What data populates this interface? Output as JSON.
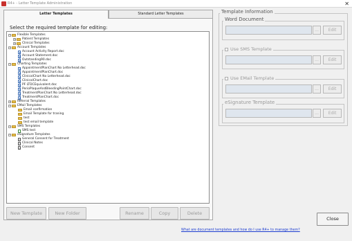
{
  "window": {
    "title": "R4+ - Letter Template Administration",
    "close_glyph": "✕"
  },
  "tabs": [
    {
      "label": "Letter Templates",
      "active": true
    },
    {
      "label": "Standard Letter Templates",
      "active": false
    }
  ],
  "tree_prompt": "Select the required template for editing:",
  "tree": {
    "flexible": {
      "label": "Flexible Templates",
      "children": [
        "Patient Templates",
        "Clinical Templates"
      ]
    },
    "account": {
      "label": "Account Templates",
      "children": [
        "Account Activity Report.doc",
        "Account Statement.doc",
        "Outstanding90.doc"
      ]
    },
    "charting": {
      "label": "Charting Templates",
      "children": [
        "AppointmentPlanChart No Letterhead.doc",
        "AppointmentPlanChart.doc",
        "ClinicalChart No Letterhead.doc",
        "ClinicalChart.doc",
        "PF LTDCEquivalent.doc",
        "PerioPlaqueAndBleedingPointChart.doc",
        "TreatmentPlanChart No Letterhead.doc",
        "TreatmentPlanChart.doc"
      ]
    },
    "referral": {
      "label": "Referral Templates"
    },
    "email": {
      "label": "EMail Templates",
      "children": [
        "Email confirmation",
        "Email Template for traning",
        "test",
        "test email template"
      ]
    },
    "sms": {
      "label": "SMS Templates",
      "children": [
        "SMS test"
      ]
    },
    "esignature": {
      "label": "eSignature Templates",
      "children": [
        "General Consent for Treatment",
        "Clinical Notes",
        "Consent"
      ]
    }
  },
  "buttons": {
    "new_template": "New Template",
    "new_folder": "New Folder",
    "rename": "Rename",
    "copy": "Copy",
    "delete": "Delete",
    "close": "Close"
  },
  "info": {
    "title": "Template Information",
    "word_document": "Word Document",
    "use_sms": "Use SMS Template",
    "use_email": "Use EMail Template",
    "esignature": "eSignature Template",
    "browse": "...",
    "edit": "Edit"
  },
  "help_link": "What are document templates and how do I use R4+ to manage them?",
  "colors": {
    "accent_link": "#1a3bd0",
    "folder": "#e8c04a",
    "field_disabled": "#dfe6ee"
  }
}
